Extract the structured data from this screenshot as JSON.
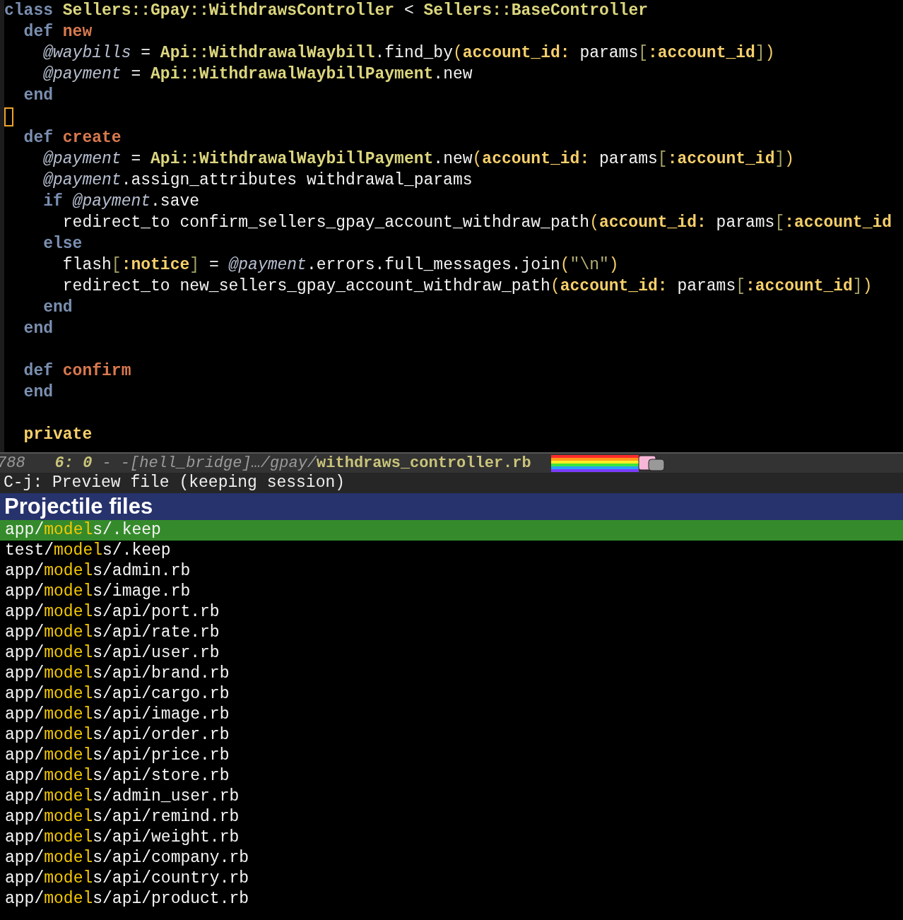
{
  "code_lines": [
    {
      "kind": "code",
      "tokens": [
        {
          "kind": "kw",
          "text": "class"
        },
        {
          "kind": "const",
          "text": " Sellers::Gpay::WithdrawsController"
        },
        {
          "kind": "plain",
          "text": " < "
        },
        {
          "kind": "const",
          "text": "Sellers::BaseController"
        }
      ]
    },
    {
      "kind": "code",
      "tokens": [
        {
          "kind": "kw",
          "text": "  def"
        },
        {
          "kind": "fn",
          "text": " new"
        }
      ]
    },
    {
      "kind": "code",
      "tokens": [
        {
          "kind": "ivar",
          "text": "    @waybills"
        },
        {
          "kind": "plain",
          "text": " = "
        },
        {
          "kind": "const",
          "text": "Api::WithdrawalWaybill"
        },
        {
          "kind": "plain",
          "text": ".find_by"
        },
        {
          "kind": "paren",
          "text": "("
        },
        {
          "kind": "sym",
          "text": "account_id:"
        },
        {
          "kind": "plain",
          "text": " params"
        },
        {
          "kind": "bracket",
          "text": "["
        },
        {
          "kind": "sym",
          "text": ":account_id"
        },
        {
          "kind": "bracket",
          "text": "]"
        },
        {
          "kind": "paren",
          "text": ")"
        }
      ]
    },
    {
      "kind": "code",
      "tokens": [
        {
          "kind": "ivar",
          "text": "    @payment"
        },
        {
          "kind": "plain",
          "text": " = "
        },
        {
          "kind": "const",
          "text": "Api::WithdrawalWaybillPayment"
        },
        {
          "kind": "plain",
          "text": ".new"
        }
      ]
    },
    {
      "kind": "code",
      "tokens": [
        {
          "kind": "kw",
          "text": "  end"
        }
      ]
    },
    {
      "kind": "cursor"
    },
    {
      "kind": "code",
      "tokens": [
        {
          "kind": "kw",
          "text": "  def"
        },
        {
          "kind": "fn",
          "text": " create"
        }
      ]
    },
    {
      "kind": "code",
      "tokens": [
        {
          "kind": "ivar",
          "text": "    @payment"
        },
        {
          "kind": "plain",
          "text": " = "
        },
        {
          "kind": "const",
          "text": "Api::WithdrawalWaybillPayment"
        },
        {
          "kind": "plain",
          "text": ".new"
        },
        {
          "kind": "paren",
          "text": "("
        },
        {
          "kind": "sym",
          "text": "account_id:"
        },
        {
          "kind": "plain",
          "text": " params"
        },
        {
          "kind": "bracket",
          "text": "["
        },
        {
          "kind": "sym",
          "text": ":account_id"
        },
        {
          "kind": "bracket",
          "text": "]"
        },
        {
          "kind": "paren",
          "text": ")"
        }
      ]
    },
    {
      "kind": "code",
      "tokens": [
        {
          "kind": "ivar",
          "text": "    @payment"
        },
        {
          "kind": "plain",
          "text": ".assign_attributes withdrawal_params"
        }
      ]
    },
    {
      "kind": "code",
      "tokens": [
        {
          "kind": "kw",
          "text": "    if"
        },
        {
          "kind": "ivar",
          "text": " @payment"
        },
        {
          "kind": "plain",
          "text": ".save"
        }
      ]
    },
    {
      "kind": "code",
      "tokens": [
        {
          "kind": "plain",
          "text": "      redirect_to confirm_sellers_gpay_account_withdraw_path"
        },
        {
          "kind": "paren",
          "text": "("
        },
        {
          "kind": "sym",
          "text": "account_id:"
        },
        {
          "kind": "plain",
          "text": " params"
        },
        {
          "kind": "bracket",
          "text": "["
        },
        {
          "kind": "sym",
          "text": ":account_id"
        }
      ]
    },
    {
      "kind": "code",
      "tokens": [
        {
          "kind": "kw",
          "text": "    else"
        }
      ]
    },
    {
      "kind": "code",
      "tokens": [
        {
          "kind": "plain",
          "text": "      flash"
        },
        {
          "kind": "bracket",
          "text": "["
        },
        {
          "kind": "sym",
          "text": ":notice"
        },
        {
          "kind": "bracket",
          "text": "]"
        },
        {
          "kind": "plain",
          "text": " = "
        },
        {
          "kind": "ivar",
          "text": "@payment"
        },
        {
          "kind": "plain",
          "text": ".errors.full_messages.join"
        },
        {
          "kind": "paren",
          "text": "("
        },
        {
          "kind": "str",
          "text": "\"\\n\""
        },
        {
          "kind": "paren",
          "text": ")"
        }
      ]
    },
    {
      "kind": "code",
      "tokens": [
        {
          "kind": "plain",
          "text": "      redirect_to new_sellers_gpay_account_withdraw_path"
        },
        {
          "kind": "paren",
          "text": "("
        },
        {
          "kind": "sym",
          "text": "account_id:"
        },
        {
          "kind": "plain",
          "text": " params"
        },
        {
          "kind": "bracket",
          "text": "["
        },
        {
          "kind": "sym",
          "text": ":account_id"
        },
        {
          "kind": "bracket",
          "text": "]"
        },
        {
          "kind": "paren",
          "text": ")"
        }
      ]
    },
    {
      "kind": "code",
      "tokens": [
        {
          "kind": "kw",
          "text": "    end"
        }
      ]
    },
    {
      "kind": "code",
      "tokens": [
        {
          "kind": "kw",
          "text": "  end"
        }
      ]
    },
    {
      "kind": "blank"
    },
    {
      "kind": "code",
      "tokens": [
        {
          "kind": "kw",
          "text": "  def"
        },
        {
          "kind": "fn",
          "text": " confirm"
        }
      ]
    },
    {
      "kind": "code",
      "tokens": [
        {
          "kind": "kw",
          "text": "  end"
        }
      ]
    },
    {
      "kind": "blank"
    },
    {
      "kind": "code",
      "tokens": [
        {
          "kind": "sym",
          "text": "  private"
        }
      ]
    }
  ],
  "mode_line": {
    "line_number": "788",
    "position": "6: 0",
    "path": "- -[hell_bridge]…/gpay/",
    "buffer_name": "withdraws_controller.rb"
  },
  "minibuffer": "C-j: Preview file (keeping session)",
  "candidates_header": "Projectile files",
  "files": [
    {
      "before": "app/",
      "match": "model",
      "after": "s/.keep",
      "selected": true
    },
    {
      "before": "test/",
      "match": "model",
      "after": "s/.keep",
      "selected": false
    },
    {
      "before": "app/",
      "match": "model",
      "after": "s/admin.rb",
      "selected": false
    },
    {
      "before": "app/",
      "match": "model",
      "after": "s/image.rb",
      "selected": false
    },
    {
      "before": "app/",
      "match": "model",
      "after": "s/api/port.rb",
      "selected": false
    },
    {
      "before": "app/",
      "match": "model",
      "after": "s/api/rate.rb",
      "selected": false
    },
    {
      "before": "app/",
      "match": "model",
      "after": "s/api/user.rb",
      "selected": false
    },
    {
      "before": "app/",
      "match": "model",
      "after": "s/api/brand.rb",
      "selected": false
    },
    {
      "before": "app/",
      "match": "model",
      "after": "s/api/cargo.rb",
      "selected": false
    },
    {
      "before": "app/",
      "match": "model",
      "after": "s/api/image.rb",
      "selected": false
    },
    {
      "before": "app/",
      "match": "model",
      "after": "s/api/order.rb",
      "selected": false
    },
    {
      "before": "app/",
      "match": "model",
      "after": "s/api/price.rb",
      "selected": false
    },
    {
      "before": "app/",
      "match": "model",
      "after": "s/api/store.rb",
      "selected": false
    },
    {
      "before": "app/",
      "match": "model",
      "after": "s/admin_user.rb",
      "selected": false
    },
    {
      "before": "app/",
      "match": "model",
      "after": "s/api/remind.rb",
      "selected": false
    },
    {
      "before": "app/",
      "match": "model",
      "after": "s/api/weight.rb",
      "selected": false
    },
    {
      "before": "app/",
      "match": "model",
      "after": "s/api/company.rb",
      "selected": false
    },
    {
      "before": "app/",
      "match": "model",
      "after": "s/api/country.rb",
      "selected": false
    },
    {
      "before": "app/",
      "match": "model",
      "after": "s/api/product.rb",
      "selected": false
    }
  ]
}
